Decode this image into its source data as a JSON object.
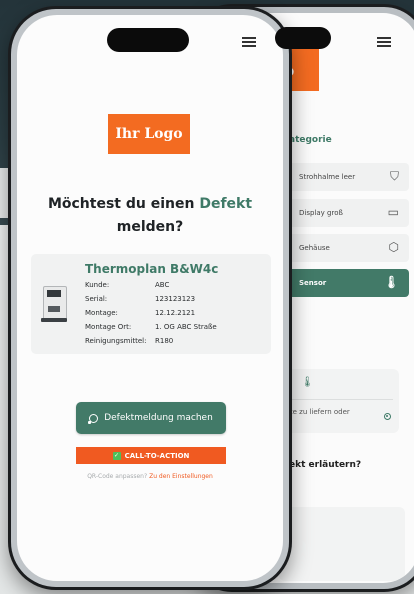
{
  "back_screen": {
    "logo_text": "ogo",
    "category_title": "ategorie",
    "items": [
      {
        "label": "Strohhalme leer",
        "icon": "cup-icon",
        "glyph": "⛉"
      },
      {
        "label": "Display groß",
        "icon": "monitor-icon",
        "glyph": "▭"
      },
      {
        "label": "Gehäuse",
        "icon": "cube-icon",
        "glyph": "⬡"
      },
      {
        "label": "Sensor",
        "icon": "thermometer-icon",
        "glyph": "🌡",
        "active": true
      }
    ],
    "panel_text": "rte zu liefern oder",
    "question": "efekt erläutern?"
  },
  "front_screen": {
    "logo_text": "Ihr Logo",
    "headline_part1": "Möchtest du einen",
    "headline_accent": "Defekt",
    "headline_part2": "melden?",
    "device": {
      "title": "Thermoplan B&W4c",
      "fields": [
        {
          "label": "Kunde:",
          "value": "ABC"
        },
        {
          "label": "Serial:",
          "value": "123123123"
        },
        {
          "label": "Montage:",
          "value": "12.12.2121"
        },
        {
          "label": "Montage Ort:",
          "value": "1. OG ABC Straße"
        },
        {
          "label": "Reinigungsmittel:",
          "value": "R180"
        }
      ]
    },
    "primary_button": "Defektmeldung machen",
    "cta_button": "CALL-TO-ACTION",
    "qr_text": "QR-Code anpassen?",
    "qr_link": "Zu den Einstellungen"
  },
  "colors": {
    "brand_orange": "#f36b21",
    "accent_green": "#427a68",
    "cta_red": "#f05a21"
  }
}
